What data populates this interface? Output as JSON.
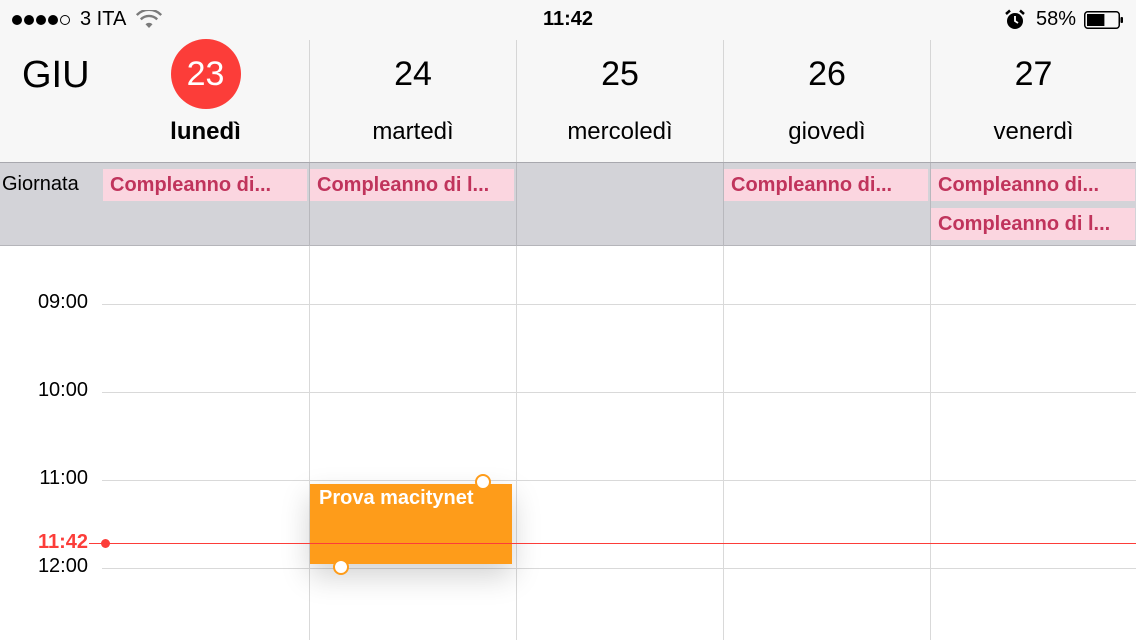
{
  "status_bar": {
    "carrier": "3 ITA",
    "time": "11:42",
    "battery": "58%",
    "battery_level": 0.58,
    "signal_bars_filled": 4,
    "signal_bars_total": 5,
    "icons": [
      "wifi-icon",
      "alarm-icon",
      "battery-icon"
    ]
  },
  "header": {
    "month": "GIU",
    "days": [
      {
        "number": "23",
        "name": "lunedì",
        "today": true
      },
      {
        "number": "24",
        "name": "martedì",
        "today": false
      },
      {
        "number": "25",
        "name": "mercoledì",
        "today": false
      },
      {
        "number": "26",
        "name": "giovedì",
        "today": false
      },
      {
        "number": "27",
        "name": "venerdì",
        "today": false
      }
    ]
  },
  "all_day": {
    "label": "Giornata",
    "events": [
      {
        "day": "lunedì",
        "title": "Compleanno di..."
      },
      {
        "day": "martedì",
        "title": "Compleanno di l..."
      },
      {
        "day": "giovedì",
        "title": "Compleanno di..."
      },
      {
        "day": "venerdì",
        "title": "Compleanno di..."
      },
      {
        "day": "venerdì",
        "title": "Compleanno di l..."
      }
    ]
  },
  "timeline": {
    "hours": [
      "09:00",
      "10:00",
      "11:00",
      "12:00"
    ],
    "now_label": "11:42"
  },
  "event": {
    "title": "Prova macitynet",
    "day": "martedì"
  },
  "colors": {
    "accent_red": "#fc3d39",
    "event_orange": "#fe9c1a",
    "allday_pink": "#fbd6e0",
    "allday_text": "#c0345c",
    "allday_bg": "#d3d3d8"
  }
}
